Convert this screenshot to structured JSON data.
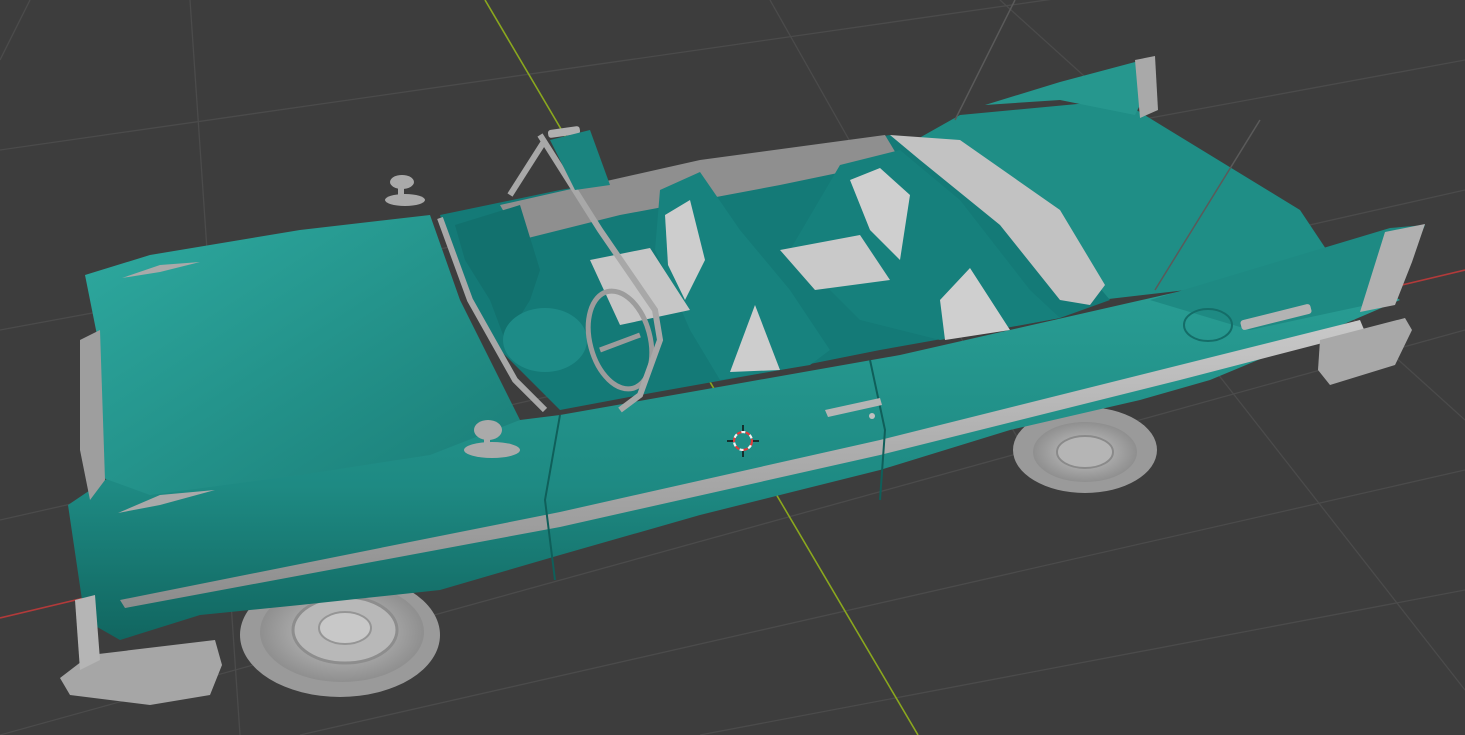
{
  "app": {
    "name": "3D Viewport",
    "view": "solid"
  },
  "colors": {
    "background": "#3d3d3d",
    "grid_line": "#4b4b4b",
    "axis_x": "#b23a3a",
    "axis_y": "#8aa71e",
    "car_body": "#1e8a83",
    "car_body_shadow": "#136d67",
    "car_body_highlight": "#2da59c",
    "interior": "#157a78",
    "chrome": "#9a9a9a",
    "chrome_light": "#b9b9b9",
    "seat_light": "#c4c4c4",
    "tire": "#a7a7a7",
    "tire_dark": "#8a8a8a",
    "cursor_red": "#e03c3c",
    "cursor_white": "#f2f2f2"
  },
  "scene": {
    "object": "convertible-car",
    "cursor": "3d-cursor-icon"
  }
}
